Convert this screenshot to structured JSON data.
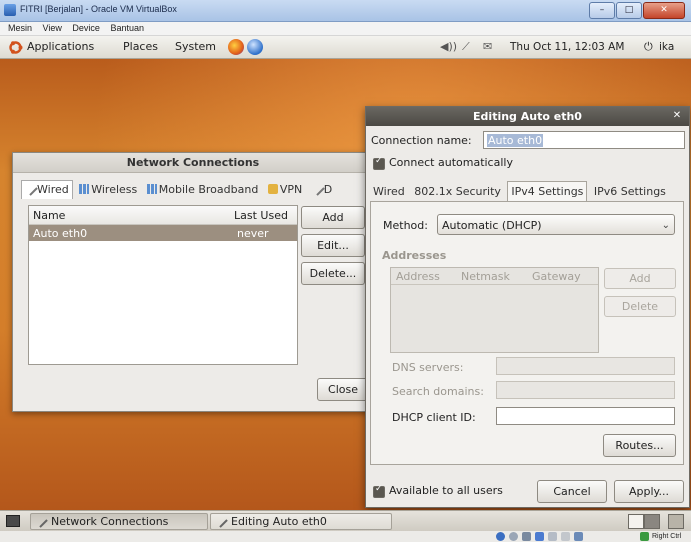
{
  "vbox": {
    "window_title": "FITRI [Berjalan] - Oracle VM VirtualBox",
    "menu": [
      "Mesin",
      "View",
      "Device",
      "Bantuan"
    ],
    "status_host_key": "Right Ctrl"
  },
  "top_panel": {
    "applications": "Applications",
    "places": "Places",
    "system": "System",
    "clock": "Thu Oct 11, 12:03 AM",
    "user": "ika"
  },
  "network_connections": {
    "title": "Network Connections",
    "tabs": [
      "Wired",
      "Wireless",
      "Mobile Broadband",
      "VPN",
      "D"
    ],
    "columns": [
      "Name",
      "Last Used"
    ],
    "rows": [
      {
        "name": "Auto eth0",
        "last_used": "never"
      }
    ],
    "buttons": {
      "add": "Add",
      "edit": "Edit...",
      "delete": "Delete...",
      "close": "Close"
    }
  },
  "editing": {
    "title": "Editing Auto eth0",
    "connection_name_label": "Connection name:",
    "connection_name_value": "Auto eth0",
    "connect_automatically": "Connect automatically",
    "tabs": [
      "Wired",
      "802.1x Security",
      "IPv4 Settings",
      "IPv6 Settings"
    ],
    "method_label": "Method:",
    "method_value": "Automatic (DHCP)",
    "addresses_label": "Addresses",
    "address_columns": [
      "Address",
      "Netmask",
      "Gateway"
    ],
    "add_button": "Add",
    "delete_button": "Delete",
    "dns_servers_label": "DNS servers:",
    "search_domains_label": "Search domains:",
    "dhcp_client_id_label": "DHCP client ID:",
    "routes_button": "Routes...",
    "available_to_all_users": "Available to all users",
    "cancel_button": "Cancel",
    "apply_button": "Apply..."
  },
  "taskbar": {
    "tasks": [
      "Network Connections",
      "Editing Auto eth0"
    ]
  }
}
